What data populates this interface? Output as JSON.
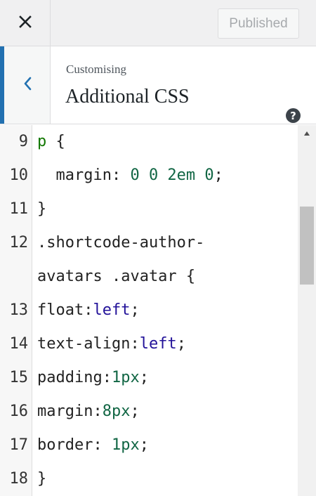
{
  "topbar": {
    "close_icon": "close-icon",
    "publish_label": "Published"
  },
  "section": {
    "back_icon": "chevron-left-icon",
    "crumb": "Customising",
    "title": "Additional CSS",
    "help_icon": "question-icon",
    "help_glyph": "?"
  },
  "editor": {
    "lines": [
      {
        "num": "9",
        "tokens": [
          {
            "t": "p",
            "c": "kw"
          },
          {
            "t": " {",
            "c": "plain"
          }
        ]
      },
      {
        "num": "10",
        "tokens": [
          {
            "t": "  margin: ",
            "c": "plain"
          },
          {
            "t": "0 0 2em 0",
            "c": "num"
          },
          {
            "t": ";",
            "c": "plain"
          }
        ]
      },
      {
        "num": "11",
        "tokens": [
          {
            "t": "}",
            "c": "plain"
          }
        ]
      },
      {
        "num": "12",
        "tokens": [
          {
            "t": ".shortcode-author-",
            "c": "plain"
          }
        ]
      },
      {
        "num": "",
        "tokens": [
          {
            "t": "avatars .avatar {",
            "c": "plain"
          }
        ]
      },
      {
        "num": "13",
        "tokens": [
          {
            "t": "float:",
            "c": "plain"
          },
          {
            "t": "left",
            "c": "atom"
          },
          {
            "t": ";",
            "c": "plain"
          }
        ]
      },
      {
        "num": "14",
        "tokens": [
          {
            "t": "text-align:",
            "c": "plain"
          },
          {
            "t": "left",
            "c": "atom"
          },
          {
            "t": ";",
            "c": "plain"
          }
        ]
      },
      {
        "num": "15",
        "tokens": [
          {
            "t": "padding:",
            "c": "plain"
          },
          {
            "t": "1px",
            "c": "num"
          },
          {
            "t": ";",
            "c": "plain"
          }
        ]
      },
      {
        "num": "16",
        "tokens": [
          {
            "t": "margin:",
            "c": "plain"
          },
          {
            "t": "8px",
            "c": "num"
          },
          {
            "t": ";",
            "c": "plain"
          }
        ]
      },
      {
        "num": "17",
        "tokens": [
          {
            "t": "border: ",
            "c": "plain"
          },
          {
            "t": "1px",
            "c": "num"
          },
          {
            "t": ";",
            "c": "plain"
          }
        ]
      },
      {
        "num": "18",
        "tokens": [
          {
            "t": "}",
            "c": "plain"
          }
        ]
      }
    ]
  },
  "colors": {
    "accent": "#2271b1",
    "keyword": "#117700",
    "number": "#116644",
    "atom": "#221199"
  }
}
